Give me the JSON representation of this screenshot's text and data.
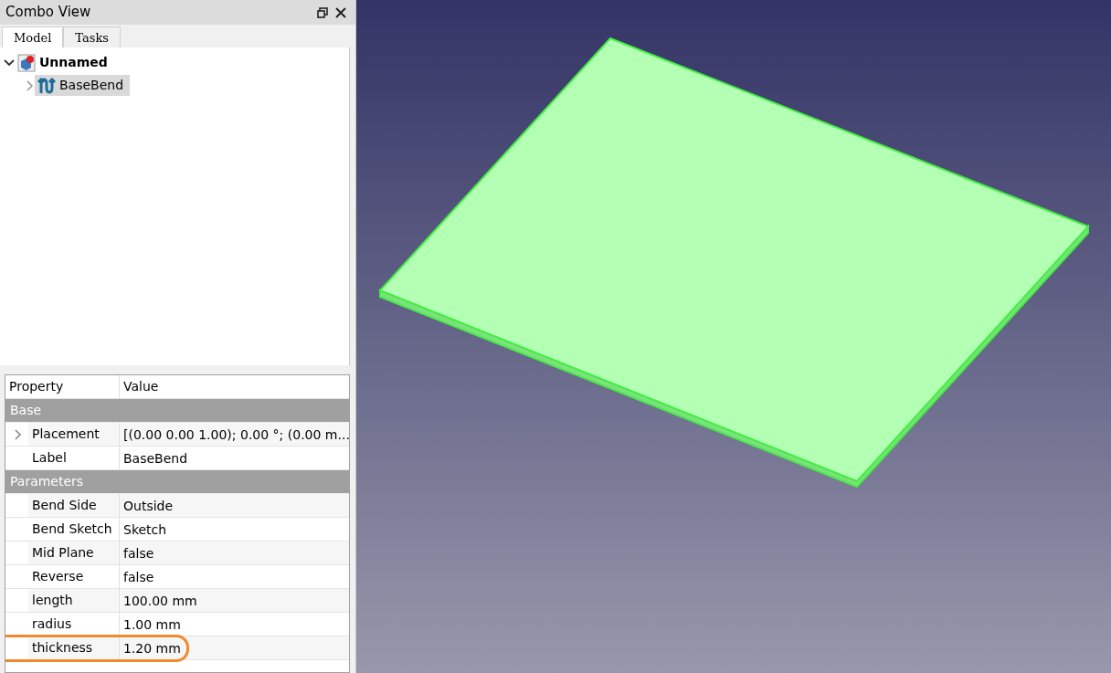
{
  "panel": {
    "title": "Combo View"
  },
  "tabs": [
    {
      "label": "Model",
      "selected": true
    },
    {
      "label": "Tasks",
      "selected": false
    }
  ],
  "tree": [
    {
      "label": "Unnamed",
      "kind": "document",
      "expanded": true,
      "selected": false,
      "children": [
        {
          "label": "BaseBend",
          "kind": "bend",
          "expanded": false,
          "selected": true,
          "has_children": true
        }
      ]
    }
  ],
  "properties": {
    "columns": [
      "Property",
      "Value"
    ],
    "groups": [
      {
        "name": "Base",
        "rows": [
          {
            "name": "Placement",
            "value": "[(0.00 0.00 1.00); 0.00 °; (0.00 m...",
            "expandable": true,
            "highlighted": false
          },
          {
            "name": "Label",
            "value": "BaseBend",
            "expandable": false,
            "highlighted": false
          }
        ]
      },
      {
        "name": "Parameters",
        "rows": [
          {
            "name": "Bend Side",
            "value": "Outside",
            "expandable": false,
            "highlighted": false
          },
          {
            "name": "Bend Sketch",
            "value": "Sketch",
            "expandable": false,
            "highlighted": false
          },
          {
            "name": "Mid Plane",
            "value": "false",
            "expandable": false,
            "highlighted": false
          },
          {
            "name": "Reverse",
            "value": "false",
            "expandable": false,
            "highlighted": false
          },
          {
            "name": "length",
            "value": "100.00 mm",
            "expandable": false,
            "highlighted": false
          },
          {
            "name": "radius",
            "value": "1.00 mm",
            "expandable": false,
            "highlighted": false
          },
          {
            "name": "thickness",
            "value": "1.20 mm",
            "expandable": false,
            "highlighted": true
          }
        ]
      }
    ]
  }
}
